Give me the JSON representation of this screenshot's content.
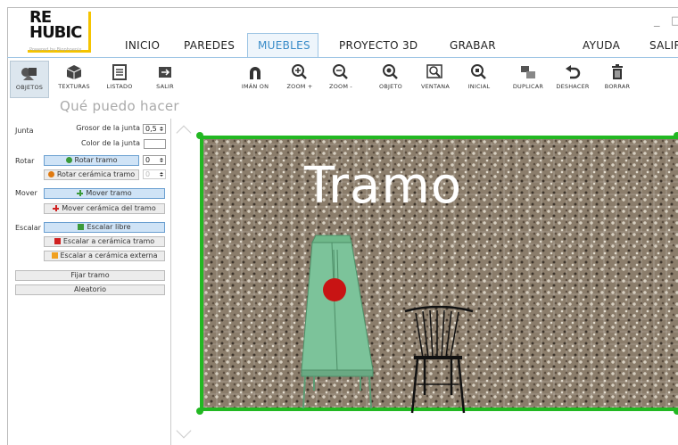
{
  "app": {
    "logo_line1": "RE",
    "logo_line2": "HUBIC",
    "logo_sub": "Powered by Biophoenix",
    "minimize": "_",
    "maximize": "□"
  },
  "menu": [
    {
      "label": "INICIO"
    },
    {
      "label": "PAREDES"
    },
    {
      "label": "MUEBLES"
    },
    {
      "label": "PROYECTO 3D"
    },
    {
      "label": "GRABAR"
    },
    {
      "label": "AYUDA"
    },
    {
      "label": "SALIR"
    }
  ],
  "toolbar": {
    "left": [
      {
        "label": "OBJETOS",
        "icon": "objects-icon"
      },
      {
        "label": "TEXTURAS",
        "icon": "cube-icon"
      },
      {
        "label": "LISTADO",
        "icon": "list-icon"
      },
      {
        "label": "SALIR",
        "icon": "exit-icon"
      }
    ],
    "right": [
      {
        "label": "IMÁN ON",
        "icon": "magnet-icon"
      },
      {
        "label": "ZOOM +",
        "icon": "zoom-in-icon"
      },
      {
        "label": "ZOOM -",
        "icon": "zoom-out-icon"
      },
      {
        "label": "OBJETO",
        "icon": "zoom-object-icon"
      },
      {
        "label": "VENTANA",
        "icon": "zoom-window-icon"
      },
      {
        "label": "INICIAL",
        "icon": "zoom-initial-icon"
      },
      {
        "label": "DUPLICAR",
        "icon": "duplicate-icon"
      },
      {
        "label": "DESHACER",
        "icon": "undo-icon"
      },
      {
        "label": "BORRAR",
        "icon": "trash-icon"
      }
    ]
  },
  "help": "Qué puedo hacer",
  "panel": {
    "junta": "Junta",
    "grosor": "Grosor de la junta",
    "grosor_val": "0,5",
    "color": "Color de la junta",
    "rotar": "Rotar",
    "rotar_tramo": "Rotar tramo",
    "rotar_tramo_val": "0",
    "rotar_ceramica": "Rotar cerámica tramo",
    "rotar_ceramica_val": "0",
    "mover": "Mover",
    "mover_tramo": "Mover tramo",
    "mover_ceramica": "Mover cerámica del tramo",
    "escalar": "Escalar",
    "escalar_libre": "Escalar libre",
    "escalar_ceramica": "Escalar a cerámica tramo",
    "escalar_externa": "Escalar a cerámica externa",
    "fijar": "Fijar tramo",
    "aleatorio": "Aleatorio"
  },
  "canvas": {
    "label": "Tramo"
  },
  "colors": {
    "accent": "#3a8cc8",
    "border": "#22b822",
    "cabinet": "#7cc39a",
    "knob": "#c81414"
  }
}
